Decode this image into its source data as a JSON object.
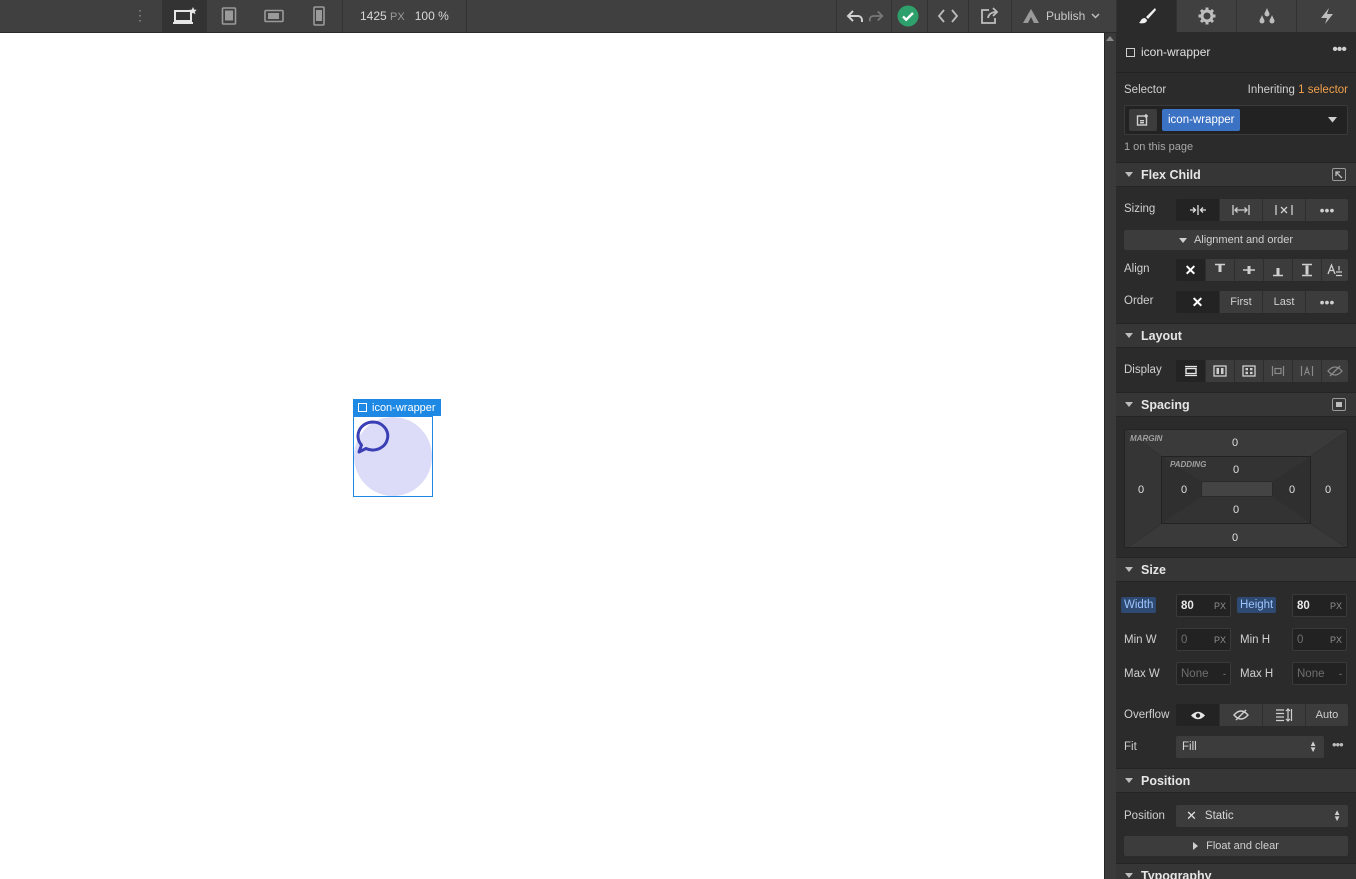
{
  "topbar": {
    "canvas_width": "1425",
    "canvas_width_unit": "PX",
    "zoom": "100 %",
    "publish_label": "Publish",
    "devices": [
      "desktop-star-icon",
      "tablet-icon",
      "mobile-landscape-icon",
      "mobile-portrait-icon"
    ],
    "status_color": "#2ea06b"
  },
  "canvas": {
    "element_tag_label": "icon-wrapper",
    "circle_color": "#dcdcf9",
    "icon_color": "#3b3fb5",
    "element_width": 80,
    "element_height": 80
  },
  "panel": {
    "header": {
      "element_name": "icon-wrapper"
    },
    "selector": {
      "label": "Selector",
      "inheriting_prefix": "Inheriting",
      "inheriting_link": "1 selector",
      "chip": "icon-wrapper",
      "count_text": "1 on this page"
    },
    "flex_child": {
      "title": "Flex Child",
      "sizing_label": "Sizing",
      "alignment_button": "Alignment and order",
      "align_label": "Align",
      "order_label": "Order",
      "order_options": [
        "First",
        "Last"
      ]
    },
    "layout": {
      "title": "Layout",
      "display_label": "Display"
    },
    "spacing": {
      "title": "Spacing",
      "margin_tag": "MARGIN",
      "padding_tag": "PADDING",
      "margin": {
        "top": "0",
        "right": "0",
        "bottom": "0",
        "left": "0"
      },
      "padding": {
        "top": "0",
        "right": "0",
        "bottom": "0",
        "left": "0"
      }
    },
    "size": {
      "title": "Size",
      "width_label": "Width",
      "width_value": "80",
      "width_unit": "PX",
      "height_label": "Height",
      "height_value": "80",
      "height_unit": "PX",
      "min_w_label": "Min W",
      "min_w_value": "0",
      "min_w_unit": "PX",
      "min_h_label": "Min H",
      "min_h_value": "0",
      "min_h_unit": "PX",
      "max_w_label": "Max W",
      "max_w_value": "None",
      "max_w_unit": "-",
      "max_h_label": "Max H",
      "max_h_value": "None",
      "max_h_unit": "-",
      "overflow_label": "Overflow",
      "overflow_auto": "Auto",
      "fit_label": "Fit",
      "fit_value": "Fill"
    },
    "position": {
      "title": "Position",
      "position_label": "Position",
      "position_value": "Static",
      "float_button": "Float and clear"
    },
    "typography": {
      "title": "Typography"
    }
  }
}
